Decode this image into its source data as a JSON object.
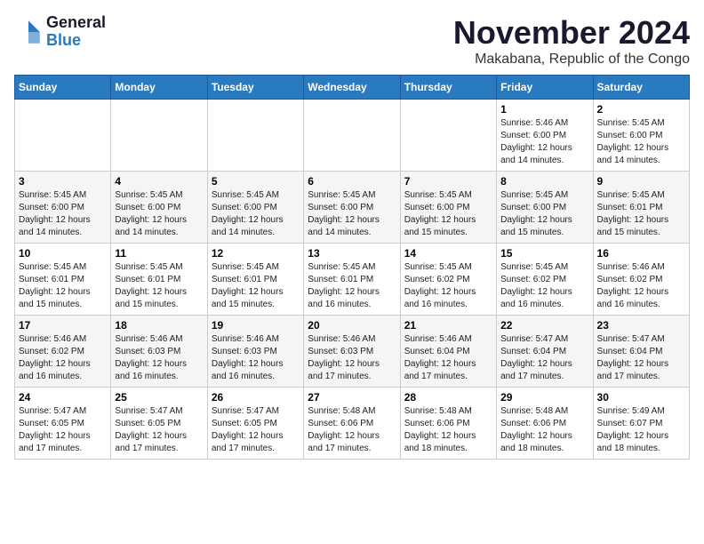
{
  "logo": {
    "line1": "General",
    "line2": "Blue"
  },
  "title": "November 2024",
  "subtitle": "Makabana, Republic of the Congo",
  "weekdays": [
    "Sunday",
    "Monday",
    "Tuesday",
    "Wednesday",
    "Thursday",
    "Friday",
    "Saturday"
  ],
  "weeks": [
    [
      {
        "day": "",
        "info": ""
      },
      {
        "day": "",
        "info": ""
      },
      {
        "day": "",
        "info": ""
      },
      {
        "day": "",
        "info": ""
      },
      {
        "day": "",
        "info": ""
      },
      {
        "day": "1",
        "info": "Sunrise: 5:46 AM\nSunset: 6:00 PM\nDaylight: 12 hours\nand 14 minutes."
      },
      {
        "day": "2",
        "info": "Sunrise: 5:45 AM\nSunset: 6:00 PM\nDaylight: 12 hours\nand 14 minutes."
      }
    ],
    [
      {
        "day": "3",
        "info": "Sunrise: 5:45 AM\nSunset: 6:00 PM\nDaylight: 12 hours\nand 14 minutes."
      },
      {
        "day": "4",
        "info": "Sunrise: 5:45 AM\nSunset: 6:00 PM\nDaylight: 12 hours\nand 14 minutes."
      },
      {
        "day": "5",
        "info": "Sunrise: 5:45 AM\nSunset: 6:00 PM\nDaylight: 12 hours\nand 14 minutes."
      },
      {
        "day": "6",
        "info": "Sunrise: 5:45 AM\nSunset: 6:00 PM\nDaylight: 12 hours\nand 14 minutes."
      },
      {
        "day": "7",
        "info": "Sunrise: 5:45 AM\nSunset: 6:00 PM\nDaylight: 12 hours\nand 15 minutes."
      },
      {
        "day": "8",
        "info": "Sunrise: 5:45 AM\nSunset: 6:00 PM\nDaylight: 12 hours\nand 15 minutes."
      },
      {
        "day": "9",
        "info": "Sunrise: 5:45 AM\nSunset: 6:01 PM\nDaylight: 12 hours\nand 15 minutes."
      }
    ],
    [
      {
        "day": "10",
        "info": "Sunrise: 5:45 AM\nSunset: 6:01 PM\nDaylight: 12 hours\nand 15 minutes."
      },
      {
        "day": "11",
        "info": "Sunrise: 5:45 AM\nSunset: 6:01 PM\nDaylight: 12 hours\nand 15 minutes."
      },
      {
        "day": "12",
        "info": "Sunrise: 5:45 AM\nSunset: 6:01 PM\nDaylight: 12 hours\nand 15 minutes."
      },
      {
        "day": "13",
        "info": "Sunrise: 5:45 AM\nSunset: 6:01 PM\nDaylight: 12 hours\nand 16 minutes."
      },
      {
        "day": "14",
        "info": "Sunrise: 5:45 AM\nSunset: 6:02 PM\nDaylight: 12 hours\nand 16 minutes."
      },
      {
        "day": "15",
        "info": "Sunrise: 5:45 AM\nSunset: 6:02 PM\nDaylight: 12 hours\nand 16 minutes."
      },
      {
        "day": "16",
        "info": "Sunrise: 5:46 AM\nSunset: 6:02 PM\nDaylight: 12 hours\nand 16 minutes."
      }
    ],
    [
      {
        "day": "17",
        "info": "Sunrise: 5:46 AM\nSunset: 6:02 PM\nDaylight: 12 hours\nand 16 minutes."
      },
      {
        "day": "18",
        "info": "Sunrise: 5:46 AM\nSunset: 6:03 PM\nDaylight: 12 hours\nand 16 minutes."
      },
      {
        "day": "19",
        "info": "Sunrise: 5:46 AM\nSunset: 6:03 PM\nDaylight: 12 hours\nand 16 minutes."
      },
      {
        "day": "20",
        "info": "Sunrise: 5:46 AM\nSunset: 6:03 PM\nDaylight: 12 hours\nand 17 minutes."
      },
      {
        "day": "21",
        "info": "Sunrise: 5:46 AM\nSunset: 6:04 PM\nDaylight: 12 hours\nand 17 minutes."
      },
      {
        "day": "22",
        "info": "Sunrise: 5:47 AM\nSunset: 6:04 PM\nDaylight: 12 hours\nand 17 minutes."
      },
      {
        "day": "23",
        "info": "Sunrise: 5:47 AM\nSunset: 6:04 PM\nDaylight: 12 hours\nand 17 minutes."
      }
    ],
    [
      {
        "day": "24",
        "info": "Sunrise: 5:47 AM\nSunset: 6:05 PM\nDaylight: 12 hours\nand 17 minutes."
      },
      {
        "day": "25",
        "info": "Sunrise: 5:47 AM\nSunset: 6:05 PM\nDaylight: 12 hours\nand 17 minutes."
      },
      {
        "day": "26",
        "info": "Sunrise: 5:47 AM\nSunset: 6:05 PM\nDaylight: 12 hours\nand 17 minutes."
      },
      {
        "day": "27",
        "info": "Sunrise: 5:48 AM\nSunset: 6:06 PM\nDaylight: 12 hours\nand 17 minutes."
      },
      {
        "day": "28",
        "info": "Sunrise: 5:48 AM\nSunset: 6:06 PM\nDaylight: 12 hours\nand 18 minutes."
      },
      {
        "day": "29",
        "info": "Sunrise: 5:48 AM\nSunset: 6:06 PM\nDaylight: 12 hours\nand 18 minutes."
      },
      {
        "day": "30",
        "info": "Sunrise: 5:49 AM\nSunset: 6:07 PM\nDaylight: 12 hours\nand 18 minutes."
      }
    ]
  ]
}
